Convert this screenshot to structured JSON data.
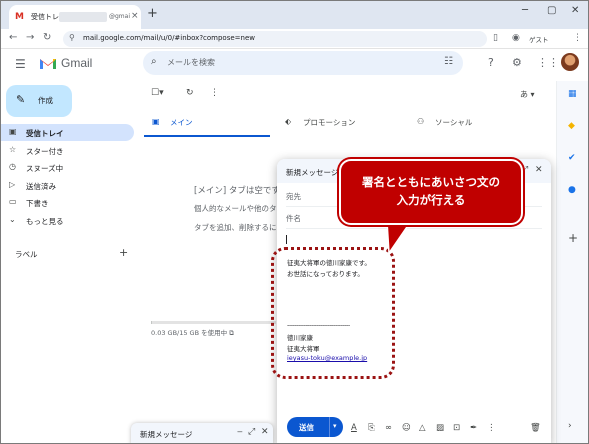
{
  "browser": {
    "tab_title": "受信トレイ",
    "tab_domain_partial": "@gmai",
    "tab_close": "×",
    "new_tab": "+",
    "url": "mail.google.com/mail/u/0/#inbox?compose=new",
    "guest_label": "ゲスト"
  },
  "header": {
    "app_name": "Gmail",
    "search_placeholder": "メールを検索"
  },
  "sidebar": {
    "compose_label": "作成",
    "items": [
      {
        "label": "受信トレイ",
        "icon": "inbox-icon",
        "glyph": "▣"
      },
      {
        "label": "スター付き",
        "icon": "star-icon",
        "glyph": "☆"
      },
      {
        "label": "スヌーズ中",
        "icon": "clock-icon",
        "glyph": "◷"
      },
      {
        "label": "送信済み",
        "icon": "send-icon",
        "glyph": "▷"
      },
      {
        "label": "下書き",
        "icon": "draft-icon",
        "glyph": "▭"
      },
      {
        "label": "もっと見る",
        "icon": "chevron-down-icon",
        "glyph": "⌄"
      }
    ],
    "labels_heading": "ラベル",
    "labels_add": "+"
  },
  "main": {
    "lang_label": "あ",
    "tabs": [
      {
        "label": "メイン",
        "icon": "inbox-icon",
        "glyph": "▣"
      },
      {
        "label": "プロモーション",
        "icon": "tag-icon",
        "glyph": "⬖"
      },
      {
        "label": "ソーシャル",
        "icon": "people-icon",
        "glyph": "⚇"
      }
    ],
    "empty_lines": [
      "[メイン] タブは空です",
      "個人的なメールや他のタ",
      "タブを追加、削除するに"
    ],
    "storage_text": "0.03 GB/15 GB を使用中",
    "storage_fraction": 0.002
  },
  "compose": {
    "title": "新規メッセージ",
    "to_label": "宛先",
    "subject_label": "件名",
    "body_lines": [
      "征夷大将軍の徳川家康です。",
      "お世話になっております。"
    ],
    "signature_separator": "----------------------------------",
    "signature_lines": [
      "徳川家康",
      "征夷大将軍"
    ],
    "signature_email": "ieyasu-toku@example.jp",
    "send_label": "送信"
  },
  "mini_compose": {
    "title": "新規メッセージ"
  },
  "callout": {
    "line1": "署名とともにあいさつ文の",
    "line2": "入力が行える"
  },
  "colors": {
    "accent_blue": "#0b57d0",
    "compose_button": "#c2e7ff",
    "active_nav": "#d3e3fd",
    "callout_red": "#c00000"
  }
}
